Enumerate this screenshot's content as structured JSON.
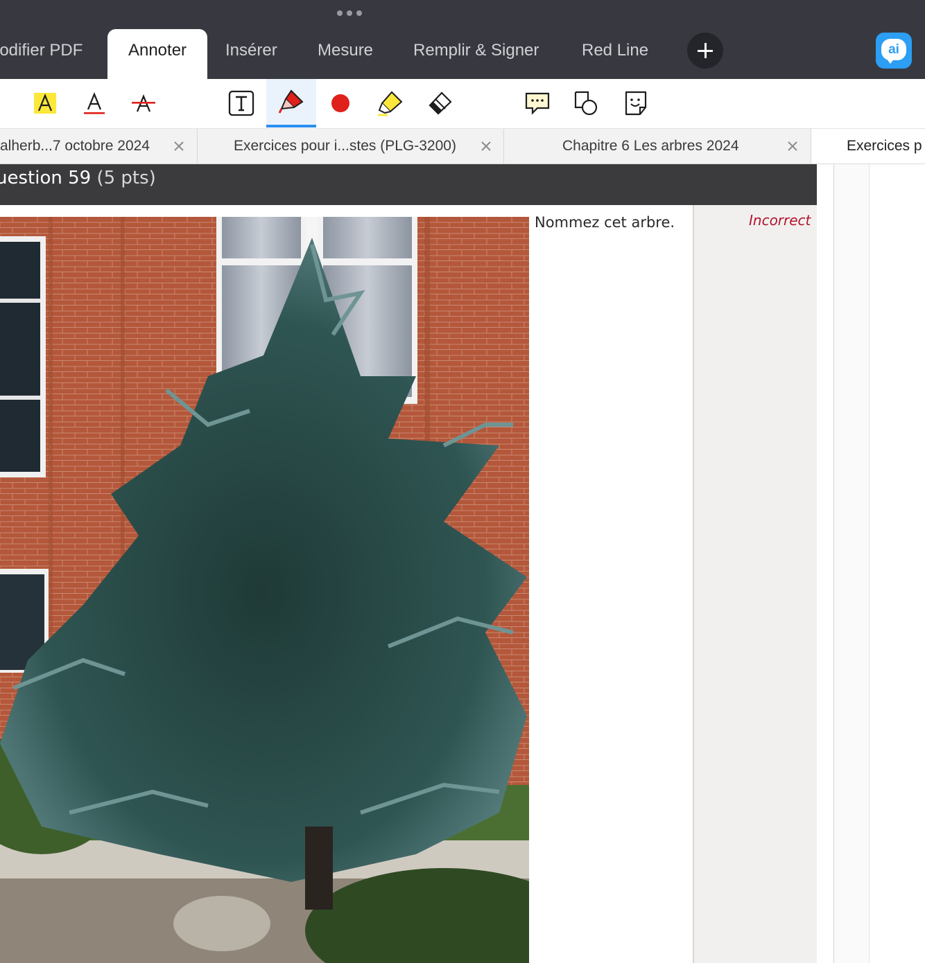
{
  "menu_bar": {
    "tabs": [
      {
        "label": "Modifier PDF",
        "visible_label": "lodifier PDF",
        "active": false
      },
      {
        "label": "Annoter",
        "active": true
      },
      {
        "label": "Insérer",
        "active": false
      },
      {
        "label": "Mesure",
        "active": false
      },
      {
        "label": "Remplir & Signer",
        "active": false
      },
      {
        "label": "Red Line",
        "active": false
      }
    ],
    "add_button_icon": "plus-icon",
    "ai_button_label": "ai",
    "ai_button_color": "#2c9ef4"
  },
  "toolbar": {
    "tools": [
      {
        "name": "text-highlight-icon",
        "active": false
      },
      {
        "name": "text-underline-icon",
        "active": false
      },
      {
        "name": "text-strikethrough-icon",
        "active": false
      },
      {
        "name": "text-box-icon",
        "active": false
      },
      {
        "name": "pen-icon",
        "active": true
      },
      {
        "name": "color-swatch-icon",
        "active": false,
        "color": "#e0201b"
      },
      {
        "name": "highlighter-icon",
        "active": false
      },
      {
        "name": "eraser-icon",
        "active": false
      },
      {
        "name": "comment-icon",
        "active": false
      },
      {
        "name": "shapes-icon",
        "active": false
      },
      {
        "name": "sticker-icon",
        "active": false
      }
    ],
    "accent_color": "#2c8ef0"
  },
  "document_tabs": [
    {
      "title": "alherb...7 octobre 2024",
      "closable": true,
      "current": false
    },
    {
      "title": "Exercices pour i...stes (PLG-3200)",
      "closable": true,
      "current": false
    },
    {
      "title": "Chapitre 6 Les arbres  2024",
      "closable": true,
      "current": false
    },
    {
      "title": "Exercices p",
      "closable": false,
      "current": true
    }
  ],
  "question": {
    "title": "uestion 59",
    "points": "(5 pts)",
    "prompt": "Nommez cet arbre.",
    "verdict": "Incorrect",
    "verdict_color": "#b3122c",
    "image_subject": "conifer tree in front of red brick building"
  }
}
